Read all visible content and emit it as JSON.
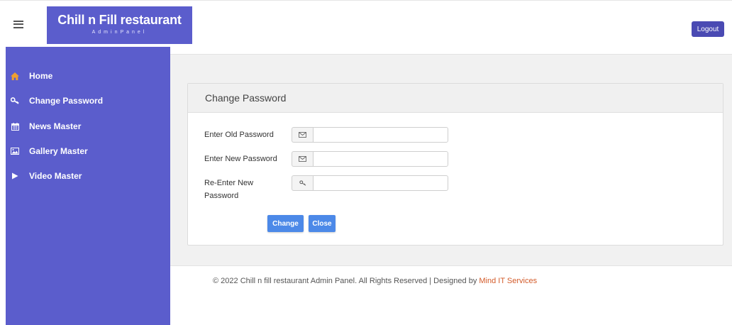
{
  "header": {
    "brand_title": "Chill n Fill restaurant",
    "brand_subtitle": "AdminPanel",
    "logout_label": "Logout"
  },
  "sidebar": {
    "items": [
      {
        "label": "Home",
        "icon": "home-icon"
      },
      {
        "label": "Change Password",
        "icon": "key-icon"
      },
      {
        "label": "News Master",
        "icon": "calendar-icon"
      },
      {
        "label": "Gallery Master",
        "icon": "image-icon"
      },
      {
        "label": "Video Master",
        "icon": "play-icon"
      }
    ]
  },
  "colors": {
    "brand": "#5b5dcc",
    "home_icon": "#f0a030",
    "button": "#4c89e8",
    "footer_link": "#d35b2a"
  },
  "panel": {
    "title": "Change Password",
    "fields": [
      {
        "label": "Enter Old Password",
        "icon": "envelope-icon",
        "value": "",
        "placeholder": ""
      },
      {
        "label": "Enter New Password",
        "icon": "envelope-icon",
        "value": "",
        "placeholder": ""
      },
      {
        "label": "Re-Enter New Password",
        "icon": "key-icon",
        "value": "",
        "placeholder": ""
      }
    ],
    "change_label": "Change",
    "close_label": "Close"
  },
  "footer": {
    "text": "© 2022 Chill n fill restaurant Admin Panel. All Rights Reserved | Designed by ",
    "link": "Mind IT Services"
  }
}
